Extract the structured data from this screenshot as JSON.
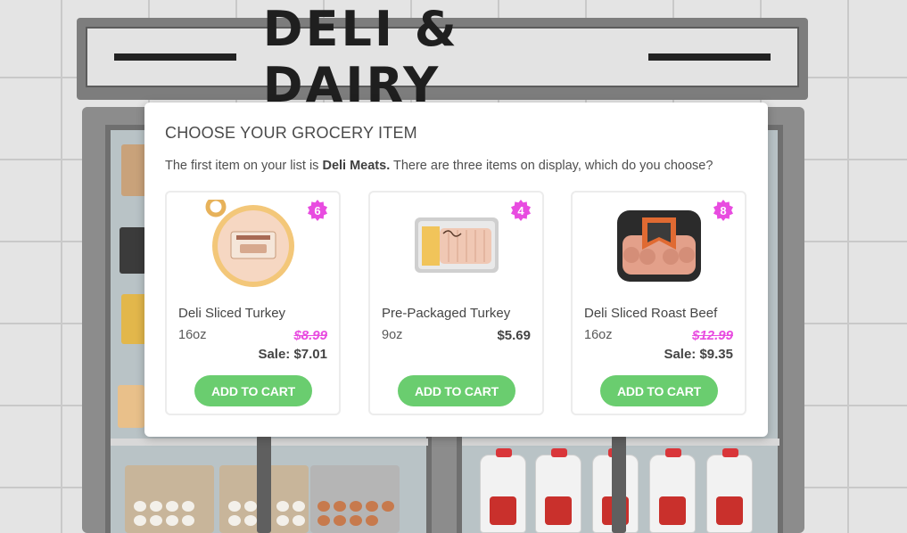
{
  "scene": {
    "sign_text": "DELI & DAIRY"
  },
  "modal": {
    "title": "CHOOSE YOUR GROCERY ITEM",
    "desc_prefix": "The first item on your list is ",
    "desc_item": "Deli Meats.",
    "desc_suffix": " There are three items on display, which do you choose?"
  },
  "colors": {
    "badge": "#e84ce0",
    "button": "#6acd6f",
    "strike_price": "#e84ce0"
  },
  "products": [
    {
      "badge": "6",
      "name": "Deli Sliced Turkey",
      "size": "16oz",
      "price": "$8.99",
      "sale": "Sale: $7.01",
      "button": "ADD TO CART",
      "icon": "deli-turkey-tub-icon"
    },
    {
      "badge": "4",
      "name": "Pre-Packaged Turkey",
      "size": "9oz",
      "price": "$5.69",
      "sale": "",
      "button": "ADD TO CART",
      "icon": "packaged-turkey-tray-icon"
    },
    {
      "badge": "8",
      "name": "Deli Sliced Roast Beef",
      "size": "16oz",
      "price": "$12.99",
      "sale": "Sale: $9.35",
      "button": "ADD TO CART",
      "icon": "roast-beef-pack-icon"
    }
  ]
}
